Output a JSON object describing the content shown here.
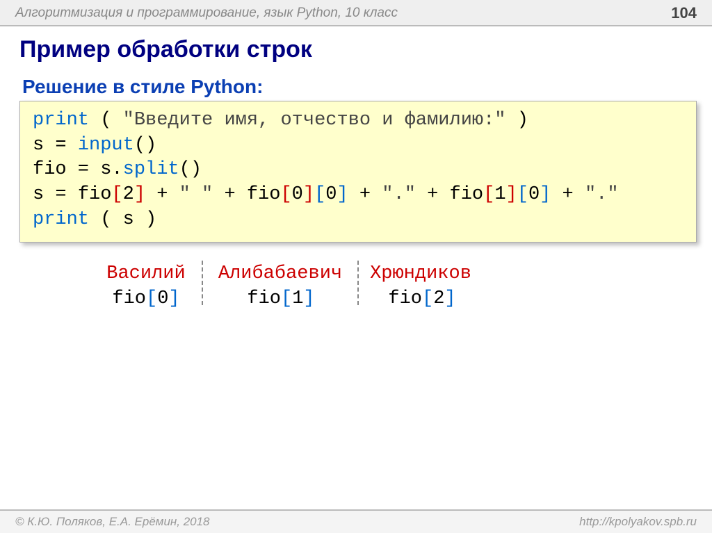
{
  "header": {
    "title": "Алгоритмизация и программирование, язык Python, 10 класс",
    "page": "104"
  },
  "h1": "Пример обработки строк",
  "h2": "Решение в стиле Python:",
  "code": {
    "l1_kw": "print",
    "l1_paren_o": " ( ",
    "l1_str": "\"Введите имя, отчество и фамилию:\"",
    "l1_paren_c": " )",
    "l2_s": "s",
    "l2_eq": " = ",
    "l2_input": "input",
    "l2_par": "()",
    "l3_fio": "fio",
    "l3_eq": " = ",
    "l3_s": "s",
    "l3_dot": ".",
    "l3_split": "split",
    "l3_par": "()",
    "l4_s": "s",
    "l4_eq": " = ",
    "l4_fio0": "fio",
    "l4_b2o": "[",
    "l4_2": "2",
    "l4_b2c": "]",
    "l4_p1": " + ",
    "l4_sp": "\" \"",
    "l4_p2": " + ",
    "l4_fio1": "fio",
    "l4_b0o": "[",
    "l4_0a": "0",
    "l4_b0c": "]",
    "l4_b0o2": "[",
    "l4_0b": "0",
    "l4_b0c2": "]",
    "l4_p3": " + ",
    "l4_dot1": "\".\"",
    "l4_p4": " + ",
    "l4_fio2": "fio",
    "l4_b1o": "[",
    "l4_1a": "1",
    "l4_b1c": "]",
    "l4_b1o2": "[",
    "l4_1b": "0",
    "l4_b1c2": "]",
    "l4_p5": " + ",
    "l4_dot2": "\".\"",
    "l5_kw": "print",
    "l5_po": " ( ",
    "l5_s": "s",
    "l5_pc": " )"
  },
  "diagram": {
    "names": [
      "Василий",
      "Алибабаевич",
      "Хрюндиков"
    ],
    "labels_prefix": "fio",
    "idx": [
      "0",
      "1",
      "2"
    ]
  },
  "footer": {
    "left": "© К.Ю. Поляков, Е.А. Ерёмин, 2018",
    "right": "http://kpolyakov.spb.ru"
  }
}
